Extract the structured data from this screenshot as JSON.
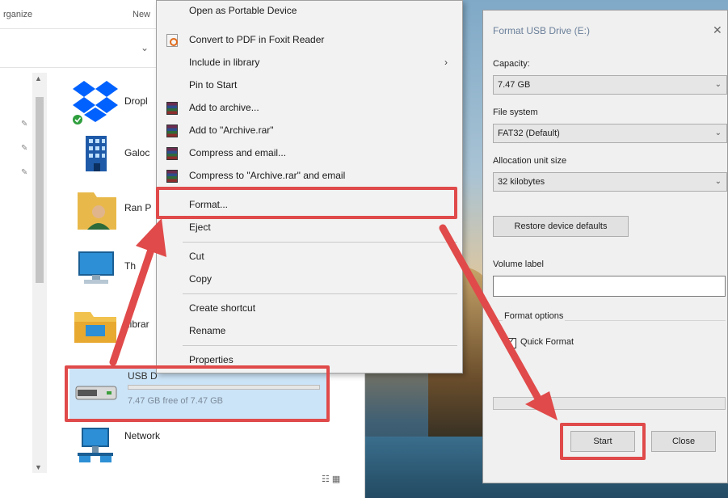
{
  "explorer": {
    "toolbar": {
      "organize_label": "rganize",
      "new_label": "New"
    },
    "items": [
      {
        "name": "Dropl",
        "icon": "dropbox-icon"
      },
      {
        "name": "Galoc",
        "icon": "building-icon"
      },
      {
        "name": "Ran P",
        "icon": "user-folder-icon"
      },
      {
        "name": "Th",
        "icon": "this-pc-icon"
      },
      {
        "name": "Librar",
        "icon": "libraries-icon"
      }
    ],
    "usb": {
      "name": "USB D",
      "free_text": "7.47 GB free of 7.47 GB",
      "used_fraction": 0.0
    },
    "network": {
      "name": "Network"
    }
  },
  "context_menu": {
    "items": [
      {
        "label": "Open as Portable Device",
        "icon": ""
      },
      {
        "label": "Convert to PDF in Foxit Reader",
        "icon": "foxit-pdf-icon"
      },
      {
        "label": "Include in library",
        "icon": "",
        "submenu": true
      },
      {
        "label": "Pin to Start",
        "icon": ""
      },
      {
        "label": "Add to archive...",
        "icon": "winrar-icon"
      },
      {
        "label": "Add to \"Archive.rar\"",
        "icon": "winrar-icon"
      },
      {
        "label": "Compress and email...",
        "icon": "winrar-icon"
      },
      {
        "label": "Compress to \"Archive.rar\" and email",
        "icon": "winrar-icon"
      },
      {
        "label": "Format...",
        "icon": "",
        "highlighted": true
      },
      {
        "label": "Eject",
        "icon": ""
      },
      {
        "label": "Cut",
        "icon": ""
      },
      {
        "label": "Copy",
        "icon": ""
      },
      {
        "label": "Create shortcut",
        "icon": ""
      },
      {
        "label": "Rename",
        "icon": ""
      },
      {
        "label": "Properties",
        "icon": ""
      }
    ],
    "submenu_glyph": "›"
  },
  "format_dialog": {
    "title": "Format USB Drive (E:)",
    "close_glyph": "✕",
    "capacity_label": "Capacity:",
    "capacity_value": "7.47 GB",
    "filesystem_label": "File system",
    "filesystem_value": "FAT32 (Default)",
    "allocation_label": "Allocation unit size",
    "allocation_value": "32 kilobytes",
    "restore_button": "Restore device defaults",
    "volume_label": "Volume label",
    "volume_value": "",
    "format_options_label": "Format options",
    "quick_format_label": "Quick Format",
    "quick_format_checked": true,
    "start_button": "Start",
    "close_button": "Close",
    "progress": 0.0
  },
  "colors": {
    "highlight": "#e04a4a",
    "selection": "#cce4f7",
    "accent": "#26a0da"
  }
}
